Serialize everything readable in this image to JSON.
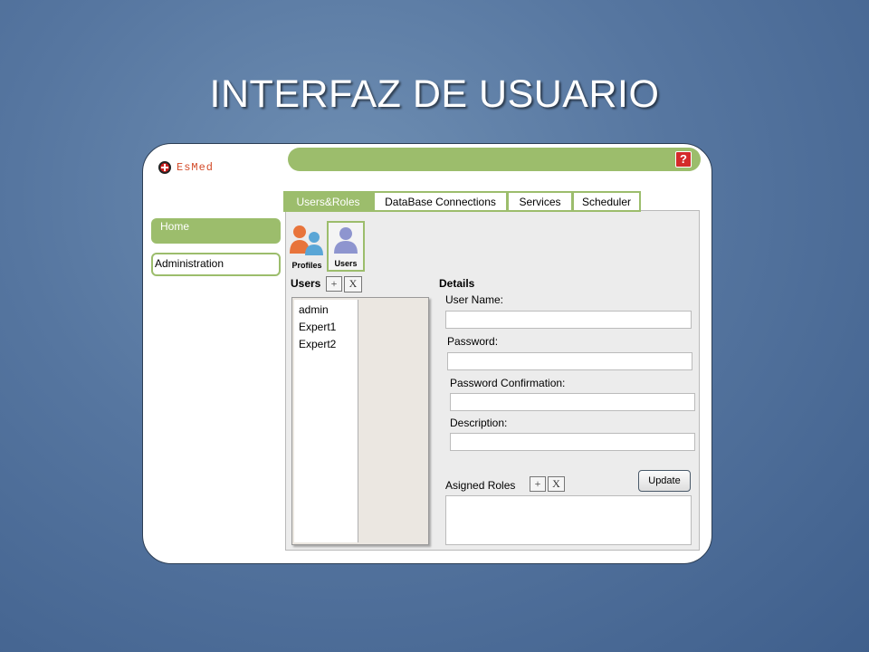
{
  "slide": {
    "title": "INTERFAZ DE USUARIO"
  },
  "app": {
    "logo_text": "EsMed",
    "help_icon": "question-mark-icon",
    "nav": {
      "home": "Home",
      "administration": "Administration"
    },
    "tabs": [
      {
        "label": "Users&Roles",
        "active": true
      },
      {
        "label": "DataBase Connections",
        "active": false
      },
      {
        "label": "Services",
        "active": false
      },
      {
        "label": "Scheduler",
        "active": false
      }
    ],
    "subtabs": [
      {
        "label": "Profiles",
        "icon": "profiles-icon"
      },
      {
        "label": "Users",
        "icon": "user-icon"
      }
    ],
    "users_panel": {
      "title": "Users",
      "add_label": "+",
      "remove_label": "X",
      "items": [
        "admin",
        "Expert1",
        "Expert2"
      ]
    },
    "details": {
      "title": "Details",
      "user_name_label": "User Name:",
      "password_label": "Password:",
      "password_confirmation_label": "Password Confirmation:",
      "description_label": "Description:",
      "roles_label": "Asigned Roles",
      "roles_add_label": "+",
      "roles_remove_label": "X",
      "update_label": "Update"
    },
    "colors": {
      "accent": "#9cbd6c",
      "background": "#5676a0"
    }
  }
}
